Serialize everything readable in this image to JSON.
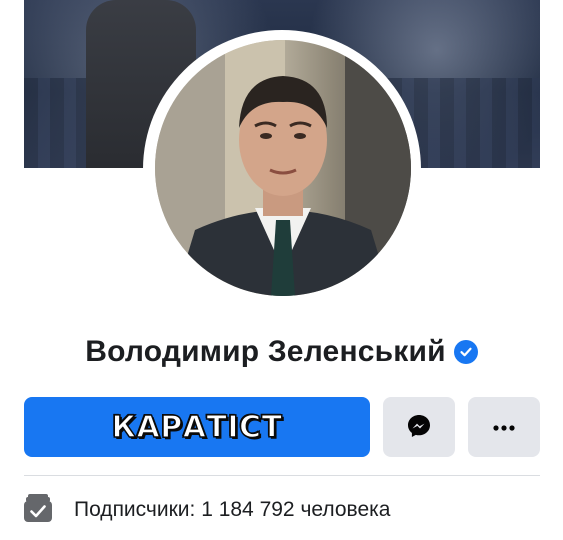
{
  "profile": {
    "name": "Володимир Зеленський",
    "verified": true
  },
  "actions": {
    "primary_label": "КАРАТІСТ",
    "messenger_icon": "messenger-icon",
    "more_icon": "more-dots-icon"
  },
  "stats": {
    "followers_text": "Подписчики: 1 184 792 человека",
    "followers_icon": "followers-check-icon"
  },
  "colors": {
    "accent": "#1877f2",
    "secondary_button": "#e4e6eb",
    "text": "#1c1e21"
  }
}
